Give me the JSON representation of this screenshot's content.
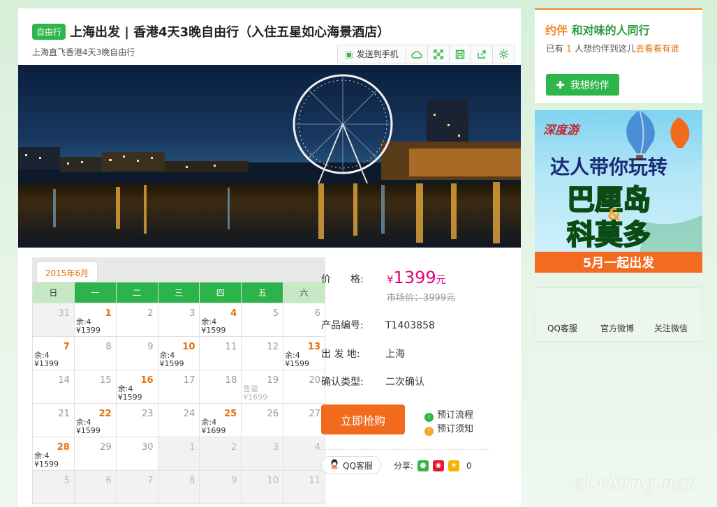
{
  "product": {
    "badge": "自由行",
    "title": "上海出发 | 香港4天3晚自由行（入住五星如心海景酒店）",
    "subtitle": "上海直飞香港4天3晚自由行"
  },
  "toolbar": {
    "send_label": "发送到手机",
    "icons": [
      "cloud-icon",
      "expand-icon",
      "save-icon",
      "share-icon",
      "settings-icon"
    ]
  },
  "calendar": {
    "month_tab": "2015年6月",
    "weekdays": [
      "日",
      "一",
      "二",
      "三",
      "四",
      "五",
      "六"
    ],
    "weeks": [
      [
        {
          "d": "31",
          "off": true
        },
        {
          "d": "1",
          "rem": "余:4",
          "price": "¥1399"
        },
        {
          "d": "2"
        },
        {
          "d": "3"
        },
        {
          "d": "4",
          "rem": "余:4",
          "price": "¥1599"
        },
        {
          "d": "5"
        },
        {
          "d": "6"
        }
      ],
      [
        {
          "d": "7",
          "rem": "余:4",
          "price": "¥1399"
        },
        {
          "d": "8"
        },
        {
          "d": "9"
        },
        {
          "d": "10",
          "rem": "余:4",
          "price": "¥1599"
        },
        {
          "d": "11"
        },
        {
          "d": "12"
        },
        {
          "d": "13",
          "rem": "余:4",
          "price": "¥1599"
        }
      ],
      [
        {
          "d": "14"
        },
        {
          "d": "15"
        },
        {
          "d": "16",
          "rem": "余:4",
          "price": "¥1599"
        },
        {
          "d": "17"
        },
        {
          "d": "18"
        },
        {
          "d": "19",
          "rem": "售罄",
          "price": "¥1699",
          "sold": true
        },
        {
          "d": "20"
        }
      ],
      [
        {
          "d": "21"
        },
        {
          "d": "22",
          "rem": "余:4",
          "price": "¥1599"
        },
        {
          "d": "23"
        },
        {
          "d": "24"
        },
        {
          "d": "25",
          "rem": "余:4",
          "price": "¥1699"
        },
        {
          "d": "26"
        },
        {
          "d": "27"
        }
      ],
      [
        {
          "d": "28",
          "rem": "余:4",
          "price": "¥1599"
        },
        {
          "d": "29"
        },
        {
          "d": "30"
        },
        {
          "d": "1",
          "off": true
        },
        {
          "d": "2",
          "off": true
        },
        {
          "d": "3",
          "off": true
        },
        {
          "d": "4",
          "off": true
        }
      ],
      [
        {
          "d": "5",
          "off": true
        },
        {
          "d": "6",
          "off": true
        },
        {
          "d": "7",
          "off": true
        },
        {
          "d": "8",
          "off": true
        },
        {
          "d": "9",
          "off": true
        },
        {
          "d": "10",
          "off": true
        },
        {
          "d": "11",
          "off": true
        }
      ]
    ]
  },
  "info": {
    "price_label": "价　　格:",
    "price_currency": "¥",
    "price_value": "1399",
    "price_unit": "元",
    "market_price": "市场价：3999元",
    "code_label": "产品编号:",
    "code_value": "T1403858",
    "depart_label": "出 发 地:",
    "depart_value": "上海",
    "confirm_label": "确认类型:",
    "confirm_value": "二次确认",
    "buy_label": "立即抢购",
    "process_label": "预订流程",
    "notice_label": "预订须知",
    "qq_label": "QQ客服",
    "share_label": "分享:",
    "share_count": "0"
  },
  "sidebar": {
    "companion_tag": "约伴",
    "companion_title": "和对味的人同行",
    "companion_line_pre": "已有",
    "companion_count": "1",
    "companion_line_mid": "人想约伴到这儿",
    "companion_link": "去看看有谁",
    "companion_button": "我想约伴",
    "ad_logo": "深度游",
    "ad_line1": "达人带你玩转",
    "ad_line2": "巴厘岛",
    "ad_amp": "&",
    "ad_line3": "科莫多",
    "ad_bar": "5月一起出发",
    "links": [
      "QQ客服",
      "官方微博",
      "关注微信"
    ]
  },
  "watermark": "eLvXing.net"
}
